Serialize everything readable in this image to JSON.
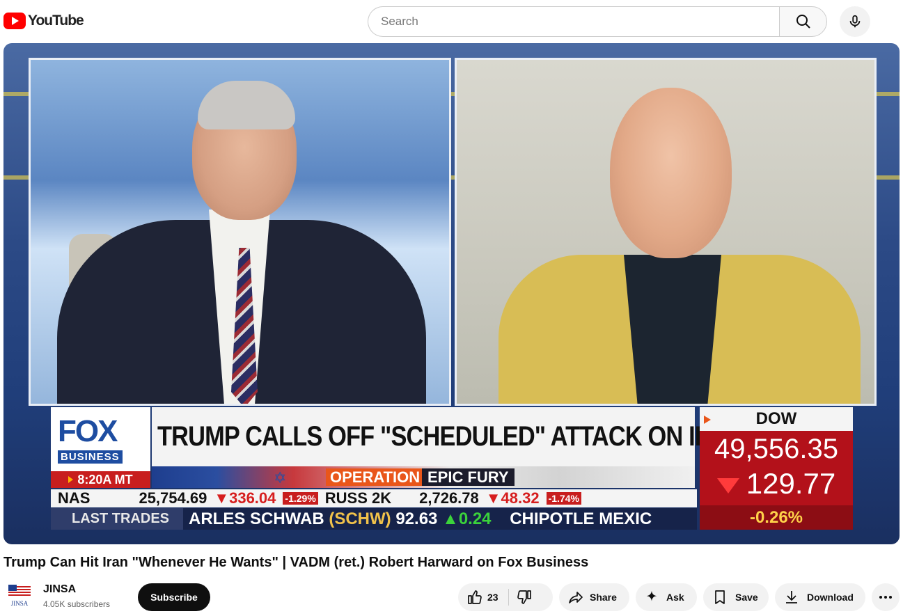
{
  "header": {
    "logo_text": "YouTube",
    "search_placeholder": "Search"
  },
  "video": {
    "lower_third": {
      "network": "FOX",
      "network_sub": "BUSINESS",
      "time": "8:20A MT",
      "headline": "TRUMP CALLS OFF \"SCHEDULED\" ATTACK ON IRAN",
      "operation_label": "OPERATION",
      "operation_name": "EPIC FURY",
      "dow_label": "DOW",
      "dow_value": "49,556.35",
      "dow_change": "129.77",
      "dow_pct": "-0.26%",
      "market_row": {
        "nas_label": "NAS",
        "nas_value": "25,754.69",
        "nas_change": "▼336.04",
        "nas_pct": "-1.29%",
        "russ_label": "RUSS 2K",
        "russ_value": "2,726.78",
        "russ_change": "▼48.32",
        "russ_pct": "-1.74%"
      },
      "trades_label": "LAST TRADES",
      "trade_company": "ARLES SCHWAB",
      "trade_ticker": "(SCHW)",
      "trade_price": "92.63",
      "trade_change": "▲0.24",
      "trade_next": "CHIPOTLE MEXIC"
    }
  },
  "meta": {
    "title": "Trump Can Hit Iran \"Whenever He Wants\" | VADM (ret.) Robert Harward on Fox Business",
    "channel_name": "JINSA",
    "channel_subs": "4.05K subscribers",
    "subscribe_label": "Subscribe",
    "like_count": "23",
    "share_label": "Share",
    "ask_label": "Ask",
    "save_label": "Save",
    "download_label": "Download"
  },
  "colors": {
    "youtube_red": "#ff0000",
    "fox_blue": "#1e4da1",
    "dow_red": "#b3111a"
  }
}
